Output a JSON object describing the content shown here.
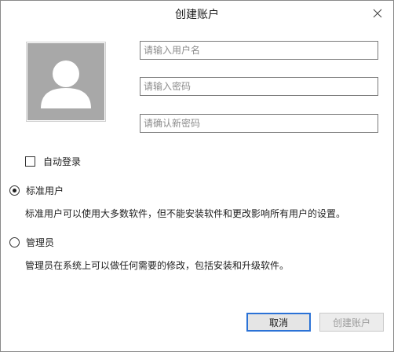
{
  "dialog": {
    "title": "创建账户"
  },
  "form": {
    "username_placeholder": "请输入用户名",
    "password_placeholder": "请输入密码",
    "confirm_placeholder": "请确认新密码",
    "auto_login_label": "自动登录",
    "auto_login_checked": false
  },
  "account_type": {
    "selected": "standard",
    "standard_label": "标准用户",
    "standard_desc": "标准用户可以使用大多数软件，但不能安装软件和更改影响所有用户的设置。",
    "admin_label": "管理员",
    "admin_desc": "管理员在系统上可以做任何需要的修改，包括安装和升级软件。"
  },
  "buttons": {
    "cancel_label": "取消",
    "create_label": "创建账户",
    "create_enabled": false
  },
  "icons": {
    "close": "close-icon",
    "avatar": "user-avatar-icon"
  },
  "colors": {
    "accent": "#2b72d6",
    "avatar_bg": "#a8a8a8"
  }
}
